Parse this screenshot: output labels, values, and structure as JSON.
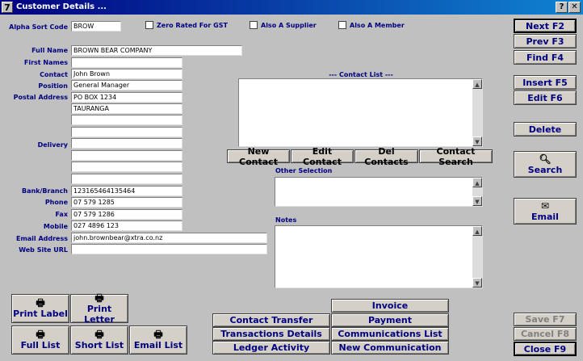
{
  "window": {
    "title": "Customer Details ...",
    "icon": "7"
  },
  "top": {
    "alpha_sort_label": "Alpha Sort Code",
    "alpha_sort_value": "BROW",
    "gst_label": "Zero Rated For GST",
    "supplier_label": "Also A Supplier",
    "member_label": "Also A Member"
  },
  "form": {
    "full_name_label": "Full Name",
    "full_name": "BROWN BEAR COMPANY",
    "first_names_label": "First Names",
    "first_names": "",
    "contact_label": "Contact",
    "contact": "John Brown",
    "position_label": "Position",
    "position": "General Manager",
    "postal_label": "Postal Address",
    "postal_1": "PO BOX 1234",
    "postal_2": "TAURANGA",
    "postal_3": "",
    "postal_4": "",
    "delivery_label": "Delivery",
    "delivery_1": "",
    "delivery_2": "",
    "delivery_3": "",
    "delivery_4": "",
    "bank_label": "Bank/Branch",
    "bank": "123165464135464",
    "phone_label": "Phone",
    "phone": "07 579 1285",
    "fax_label": "Fax",
    "fax": "07 579 1286",
    "mobile_label": "Mobile",
    "mobile": "027 4896 123",
    "email_label": "Email Address",
    "email": "john.brownbear@xtra.co.nz",
    "web_label": "Web Site URL",
    "web": ""
  },
  "contact_list": {
    "title": "--- Contact List ---",
    "buttons": {
      "new": "New Contact",
      "edit": "Edit Contact",
      "del": "Del Contacts",
      "search": "Contact Search"
    }
  },
  "other_selection_label": "Other Selection",
  "notes_label": "Notes",
  "right_buttons": {
    "next": "Next F2",
    "prev": "Prev F3",
    "find": "Find F4",
    "insert": "Insert F5",
    "edit": "Edit F6",
    "delete": "Delete",
    "search": "Search",
    "email": "Email",
    "save": "Save F7",
    "cancel": "Cancel F8",
    "close": "Close F9"
  },
  "print_buttons": {
    "print_label": "Print Label",
    "print_letter": "Print Letter",
    "full_list": "Full List",
    "short_list": "Short List",
    "email_list": "Email List"
  },
  "bottom_buttons": {
    "invoice": "Invoice",
    "contact_transfer": "Contact Transfer",
    "payment": "Payment",
    "transactions_details": "Transactions Details",
    "communications_list": "Communications List",
    "ledger_activity": "Ledger Activity",
    "new_communication": "New Communication"
  },
  "icons": {
    "printer": "printer-icon",
    "magnifier": "magnifier-icon",
    "email": "email-icon"
  }
}
